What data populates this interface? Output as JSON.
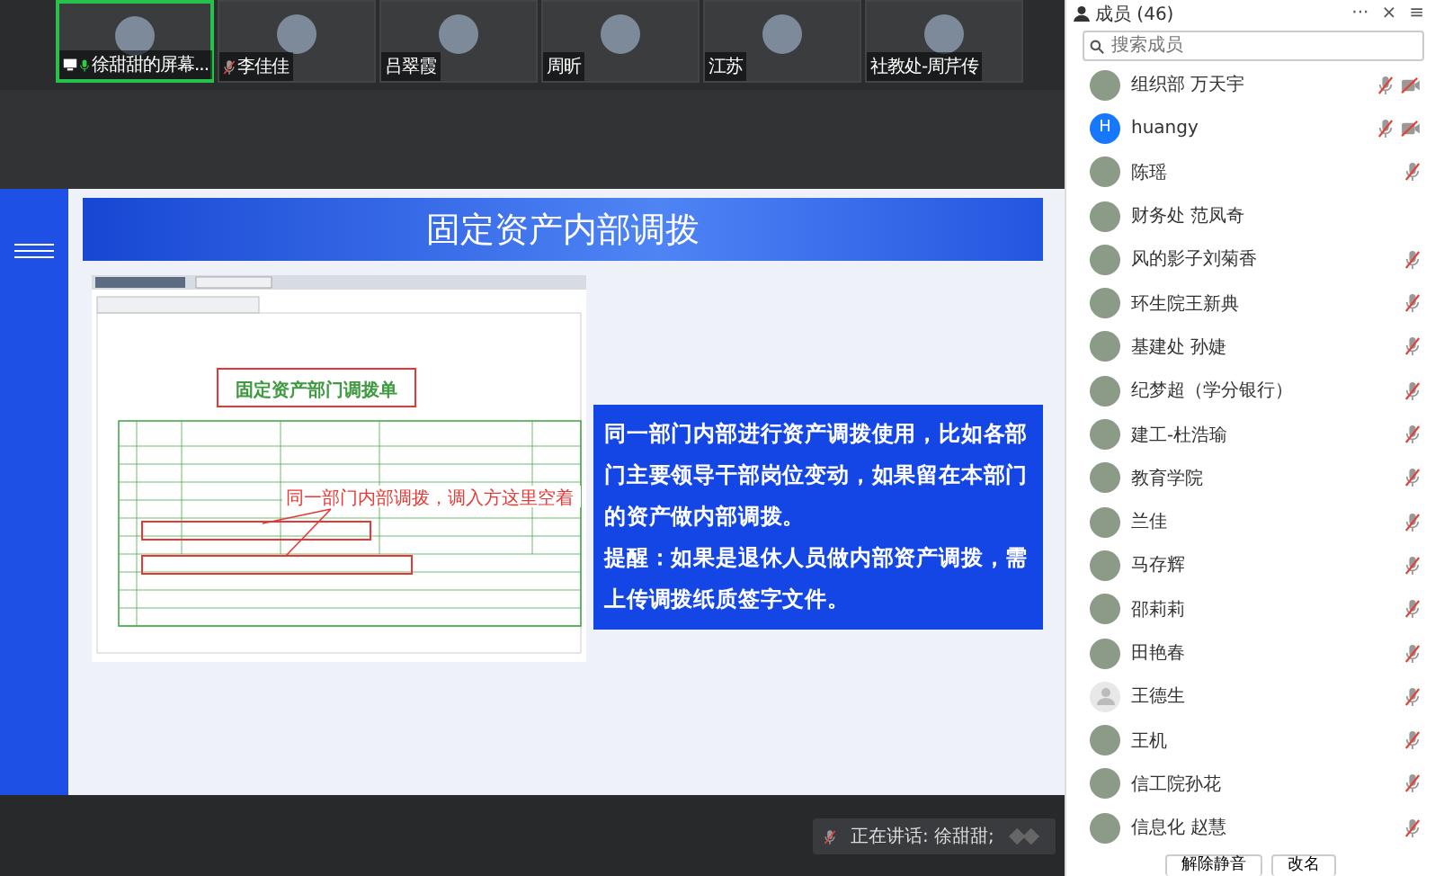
{
  "video_tiles": [
    {
      "name": "徐甜甜的屏幕...",
      "selected": true,
      "sharing": true,
      "mic_on": true,
      "mic_muted": false
    },
    {
      "name": "李佳佳",
      "selected": false,
      "sharing": false,
      "mic_on": false,
      "mic_muted": true
    },
    {
      "name": "吕翠霞",
      "selected": false,
      "sharing": false,
      "mic_on": false,
      "mic_muted": false
    },
    {
      "name": "周昕",
      "selected": false,
      "sharing": false,
      "mic_on": false,
      "mic_muted": false
    },
    {
      "name": "江苏",
      "selected": false,
      "sharing": false,
      "mic_on": false,
      "mic_muted": false
    },
    {
      "name": "社教处-周芹传",
      "selected": false,
      "sharing": false,
      "mic_on": false,
      "mic_muted": false
    }
  ],
  "slide": {
    "title": "固定资产内部调拨",
    "document": {
      "form_title": "固定资产部门调拨单",
      "annotation": "同一部门内部调拨，调入方这里空着"
    },
    "note": [
      "同一部门内部进行资产调拨使用，比如各部门主要领导干部岗位变动，如果留在本部门的资产做内部调拨。",
      "提醒：如果是退休人员做内部资产调拨，需上传调拨纸质签字文件。"
    ]
  },
  "speaking": {
    "text": "正在讲话: 徐甜甜;"
  },
  "members_panel": {
    "title": "成员 (46)",
    "more": "···",
    "close": "×",
    "menu": "≡",
    "search": {
      "placeholder": "搜索成员"
    },
    "members": [
      {
        "name": "组织部 万天宇",
        "kind": "photo",
        "mic_muted": true,
        "video_off": true
      },
      {
        "name": "huangy",
        "kind": "letter",
        "letter": "H",
        "mic_muted": true,
        "video_off": true
      },
      {
        "name": "陈瑶",
        "kind": "photo",
        "mic_muted": true,
        "video_off": false
      },
      {
        "name": "财务处 范凤奇",
        "kind": "photo",
        "mic_muted": false,
        "video_off": false
      },
      {
        "name": "风的影子刘菊香",
        "kind": "photo",
        "mic_muted": true,
        "video_off": false
      },
      {
        "name": "环生院王新典",
        "kind": "photo",
        "mic_muted": true,
        "video_off": false
      },
      {
        "name": "基建处 孙婕",
        "kind": "photo",
        "mic_muted": true,
        "video_off": false
      },
      {
        "name": "纪梦超（学分银行）",
        "kind": "photo",
        "mic_muted": true,
        "video_off": false
      },
      {
        "name": "建工-杜浩瑜",
        "kind": "photo",
        "mic_muted": true,
        "video_off": false
      },
      {
        "name": "教育学院",
        "kind": "photo",
        "mic_muted": true,
        "video_off": false
      },
      {
        "name": "兰佳",
        "kind": "photo",
        "mic_muted": true,
        "video_off": false
      },
      {
        "name": "马存辉",
        "kind": "photo",
        "mic_muted": true,
        "video_off": false
      },
      {
        "name": "邵莉莉",
        "kind": "photo",
        "mic_muted": true,
        "video_off": false
      },
      {
        "name": "田艳春",
        "kind": "photo",
        "mic_muted": true,
        "video_off": false
      },
      {
        "name": "王德生",
        "kind": "default",
        "mic_muted": true,
        "video_off": false
      },
      {
        "name": "王机",
        "kind": "photo",
        "mic_muted": true,
        "video_off": false
      },
      {
        "name": "信工院孙花",
        "kind": "photo",
        "mic_muted": true,
        "video_off": false
      },
      {
        "name": "信息化 赵慧",
        "kind": "photo",
        "mic_muted": true,
        "video_off": false
      }
    ],
    "buttons": [
      "解除静音",
      "改名"
    ]
  }
}
